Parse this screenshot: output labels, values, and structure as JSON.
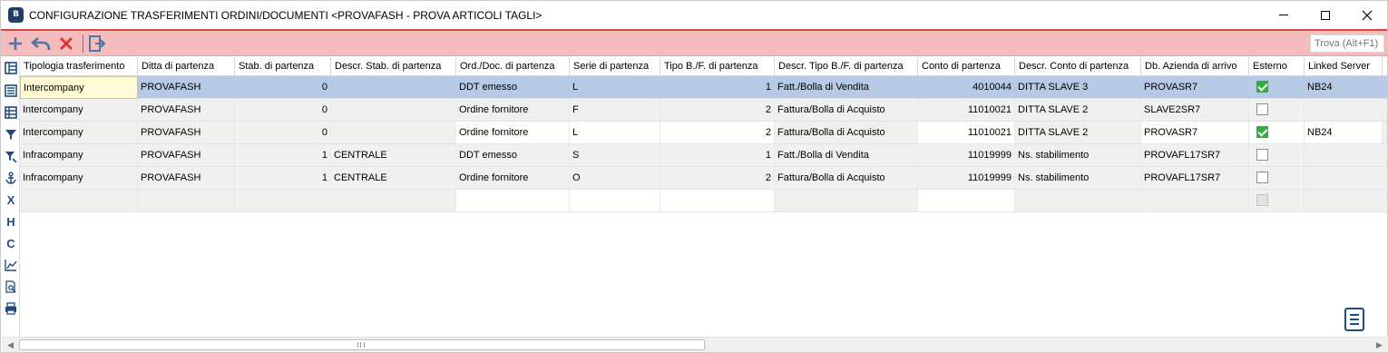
{
  "window": {
    "app_icon_text": "B",
    "title": "CONFIGURAZIONE TRASFERIMENTI ORDINI/DOCUMENTI <PROVAFASH - PROVA ARTICOLI TAGLI>"
  },
  "toolbar": {
    "add_icon": "plus-icon",
    "undo_icon": "undo-icon",
    "delete_icon": "x-icon",
    "exit_icon": "exit-icon",
    "search_placeholder": "Trova (Alt+F1)",
    "accent_color": "#e04848",
    "background_color": "#f4bcbc"
  },
  "sidebar": {
    "items": [
      "layout-icon",
      "list-icon",
      "grid-icon",
      "filter-icon",
      "filter-edit-icon",
      "anchor-icon",
      "x-marker-icon",
      "h-marker-icon",
      "c-marker-icon",
      "chart-icon",
      "preview-icon",
      "print-icon"
    ],
    "labels": {
      "x": "X",
      "h": "H",
      "c": "C"
    }
  },
  "grid": {
    "columns": [
      "Tipologia trasferimento",
      "Ditta di partenza",
      "Stab. di partenza",
      "Descr. Stab. di partenza",
      "Ord./Doc. di partenza",
      "Serie di partenza",
      "Tipo B./F. di partenza",
      "Descr. Tipo B./F. di partenza",
      "Conto di partenza",
      "Descr. Conto di partenza",
      "Db. Azienda di arrivo",
      "Esterno",
      "Linked Server"
    ],
    "rows": [
      {
        "tipologia": "Intercompany",
        "ditta": "PROVAFASH",
        "stab": "0",
        "descr_stab": "",
        "ord_doc": "DDT emesso",
        "serie": "L",
        "tipo": "1",
        "descr_tipo": "Fatt./Bolla di Vendita",
        "conto": "4010044",
        "descr_conto": "DITTA SLAVE 3",
        "db": "PROVASR7",
        "esterno": true,
        "linked": "NB24"
      },
      {
        "tipologia": "Intercompany",
        "ditta": "PROVAFASH",
        "stab": "0",
        "descr_stab": "",
        "ord_doc": "Ordine fornitore",
        "serie": "F",
        "tipo": "2",
        "descr_tipo": "Fattura/Bolla di Acquisto",
        "conto": "11010021",
        "descr_conto": "DITTA SLAVE 2",
        "db": "SLAVE2SR7",
        "esterno": false,
        "linked": ""
      },
      {
        "tipologia": "Intercompany",
        "ditta": "PROVAFASH",
        "stab": "0",
        "descr_stab": "",
        "ord_doc": "Ordine fornitore",
        "serie": "L",
        "tipo": "2",
        "descr_tipo": "Fattura/Bolla di Acquisto",
        "conto": "11010021",
        "descr_conto": "DITTA SLAVE 2",
        "db": "PROVASR7",
        "esterno": true,
        "linked": "NB24"
      },
      {
        "tipologia": "Infracompany",
        "ditta": "PROVAFASH",
        "stab": "1",
        "descr_stab": "CENTRALE",
        "ord_doc": "DDT emesso",
        "serie": "S",
        "tipo": "1",
        "descr_tipo": "Fatt./Bolla di Vendita",
        "conto": "11019999",
        "descr_conto": "Ns. stabilimento",
        "db": "PROVAFL17SR7",
        "esterno": false,
        "linked": ""
      },
      {
        "tipologia": "Infracompany",
        "ditta": "PROVAFASH",
        "stab": "1",
        "descr_stab": "CENTRALE",
        "ord_doc": "Ordine fornitore",
        "serie": "O",
        "tipo": "2",
        "descr_tipo": "Fattura/Bolla di Acquisto",
        "conto": "11019999",
        "descr_conto": "Ns. stabilimento",
        "db": "PROVAFL17SR7",
        "esterno": false,
        "linked": ""
      }
    ],
    "selected_row_color": "#b7cae5",
    "check_color": "#2fb13e"
  }
}
